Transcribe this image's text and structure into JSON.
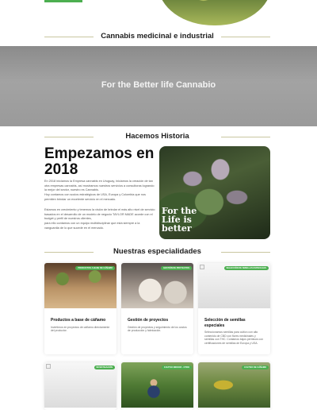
{
  "titles": {
    "medicinal": "Cannabis medicinal e industrial",
    "historia": "Hacemos Historia",
    "especialidades": "Nuestras especialidades"
  },
  "banner": {
    "text": "For the Better life Cannabio"
  },
  "history": {
    "heading": "Empezamos en 2018",
    "paragraphs": [
      "En 2018 iniciamos la Empresa cannabis en Uruguay, iniciamos la creación de tan otra empresas cannabis, así mostramos nuestros servicios a consultoras logrando la mejor del sector, nuestro es Cannabis.",
      "Hoy contamos con socios estratégicos de USA, Europa y Colombia que nos permiten brindar un excelente servicio en el mercado.",
      "Estamos en crecimiento y tenemos la visión de brindar el más alto nivel de servicio basados en el desarrollo de un modelo de negocio TAYLOR MADE acorde con el budget y perfil de nuestros clientes,",
      "para ello contamos con un equipo multidisciplinar que está siempre a la vanguardia de lo que sucede en el mercado."
    ],
    "image_text": "For the\nLife is\nbetter"
  },
  "cards": [
    {
      "badge": "PRODUCTOS A BASE DE CÁÑAMO",
      "title": "Productos a base de cáñamo",
      "desc": "Invertimos en proyectos de cáñamo directamente del productor."
    },
    {
      "badge": "GESTIÓN DE PROYECTOS",
      "title": "Gestión de proyectos",
      "desc": "Gestión de proyectos y seguimiento de los costos de producción y fabricación."
    },
    {
      "badge": "SELECCIÓN DE SEMILLAS ESPECIALES",
      "title": "Selección de semillas especiales",
      "desc": "Seleccionamos semillas para cultivo con alto contenido de CBD con flores medicinales y semillas con THC. Contamos bajos permisos con certificaciones de semillas de Europa y USA."
    },
    {
      "badge": "INVESTIGACIÓN",
      "title": "",
      "desc": ""
    },
    {
      "badge": "CULTIVO INDOOR - OTRO",
      "title": "",
      "desc": ""
    },
    {
      "badge": "CULTIVO DE CÁÑAMO",
      "title": "",
      "desc": ""
    }
  ],
  "colors": {
    "accent": "#4caf50",
    "banner_gray": "#9a9a9a"
  }
}
